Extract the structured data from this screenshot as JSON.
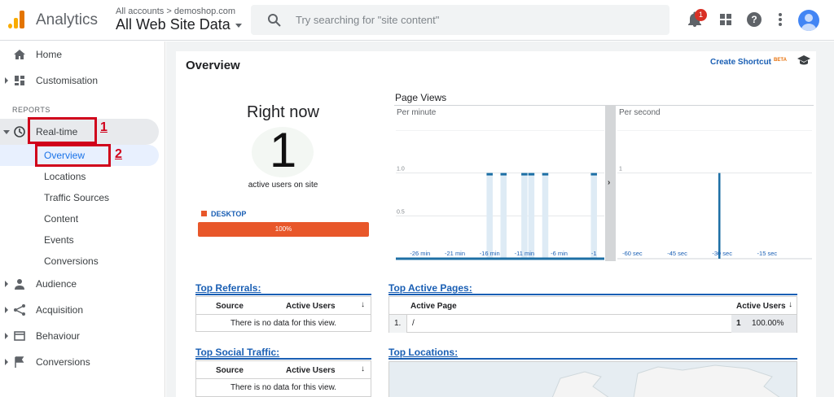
{
  "header": {
    "app_name": "Analytics",
    "account_crumb": "All accounts > demoshop.com",
    "view_name": "All Web Site Data",
    "search_placeholder": "Try searching for \"site content\"",
    "notification_count": "1"
  },
  "sidebar": {
    "home": "Home",
    "customisation": "Customisation",
    "section_reports": "REPORTS",
    "realtime": "Real-time",
    "realtime_items": [
      "Overview",
      "Locations",
      "Traffic Sources",
      "Content",
      "Events",
      "Conversions"
    ],
    "audience": "Audience",
    "acquisition": "Acquisition",
    "behaviour": "Behaviour",
    "conversions": "Conversions"
  },
  "annotations": {
    "marker_1": "1",
    "marker_2": "2",
    "color": "#d0021b"
  },
  "main": {
    "title": "Overview",
    "create_shortcut": "Create Shortcut",
    "beta": "BETA",
    "right_now": {
      "title": "Right now",
      "count": "1",
      "subtitle": "active users on site",
      "device_label": "DESKTOP",
      "device_percent": "100%",
      "device_share": 1.0
    },
    "page_views": {
      "title": "Page Views",
      "per_minute_label": "Per minute",
      "per_second_label": "Per second"
    },
    "top_referrals": {
      "title": "Top Referrals:",
      "col_source": "Source",
      "col_active": "Active Users",
      "empty": "There is no data for this view."
    },
    "top_social": {
      "title": "Top Social Traffic:",
      "col_source": "Source",
      "col_active": "Active Users",
      "empty": "There is no data for this view."
    },
    "top_pages": {
      "title": "Top Active Pages:",
      "col_page": "Active Page",
      "col_active": "Active Users",
      "rows": [
        {
          "index": "1.",
          "page": "/",
          "users": "1",
          "percent": "100.00%"
        }
      ]
    },
    "top_locations": {
      "title": "Top Locations:"
    }
  },
  "chart_data": [
    {
      "type": "bar",
      "title": "Page Views",
      "subtitle": "Per minute",
      "y_ticks": [
        "0.5",
        "1.0",
        "1.5"
      ],
      "ylim": [
        0,
        1.5
      ],
      "x_tick_labels": [
        "-26 min",
        "-21 min",
        "-16 min",
        "-11 min",
        "-6 min",
        "-1"
      ],
      "x": [
        -29,
        -28,
        -27,
        -26,
        -25,
        -24,
        -23,
        -22,
        -21,
        -20,
        -19,
        -18,
        -17,
        -16,
        -15,
        -14,
        -13,
        -12,
        -11,
        -10,
        -9,
        -8,
        -7,
        -6,
        -5,
        -4,
        -3,
        -2,
        -1,
        0
      ],
      "values": [
        0,
        0,
        0,
        0,
        0,
        0,
        0,
        0,
        0,
        0,
        0,
        0,
        0,
        1,
        0,
        1,
        0,
        0,
        1,
        1,
        0,
        1,
        0,
        0,
        0,
        0,
        0,
        0,
        1,
        0
      ],
      "color": "#1d6fa5"
    },
    {
      "type": "bar",
      "subtitle": "Per second",
      "y_ticks": [
        "1",
        "1.5"
      ],
      "ylim": [
        0,
        1.5
      ],
      "x_tick_labels": [
        "-60 sec",
        "-45 sec",
        "-30 sec",
        "-15 sec"
      ],
      "x": [
        -31
      ],
      "values": [
        1
      ],
      "color": "#1d6fa5"
    }
  ]
}
